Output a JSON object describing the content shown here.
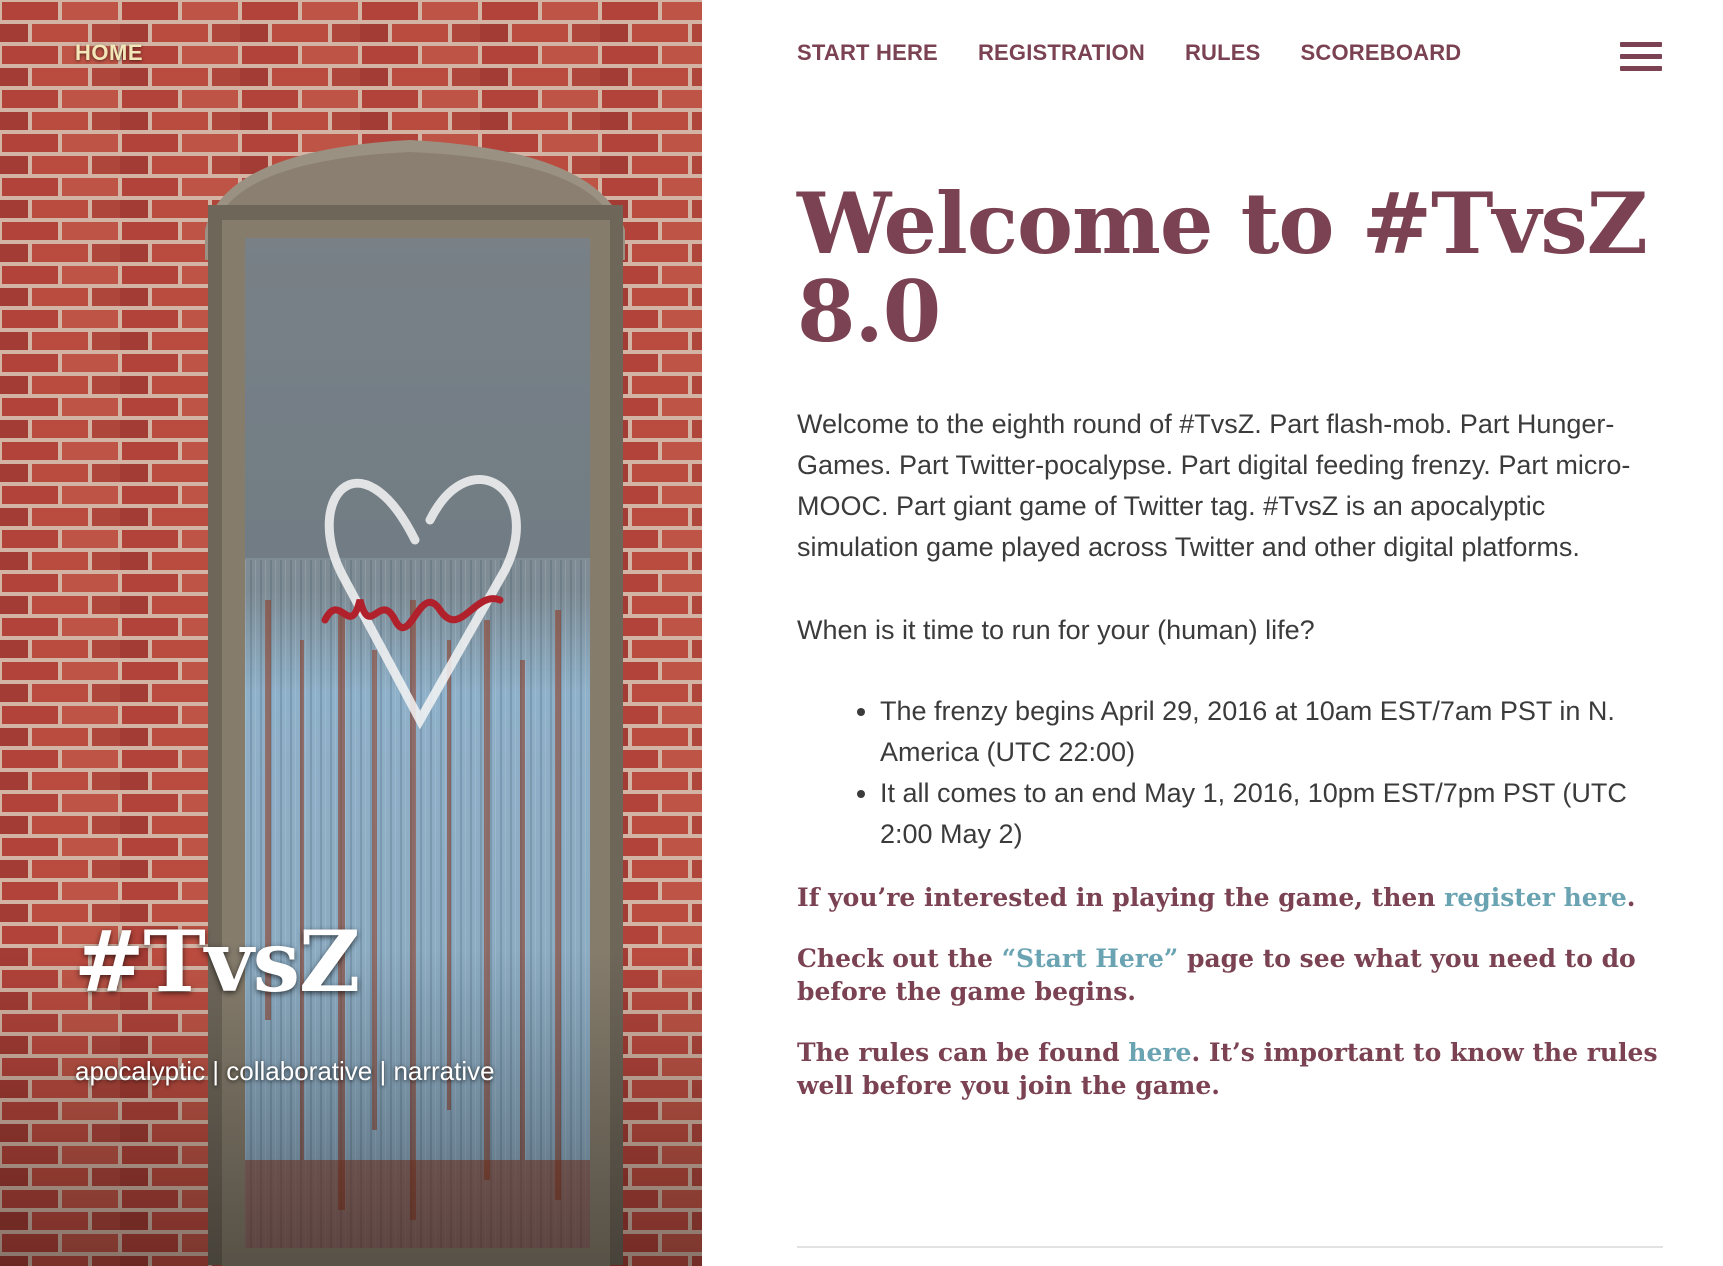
{
  "hero": {
    "home_label": "HOME",
    "site_title": "#TvsZ",
    "tagline": "apocalyptic | collaborative | narrative"
  },
  "nav": {
    "items": [
      {
        "label": "START HERE"
      },
      {
        "label": "REGISTRATION"
      },
      {
        "label": "RULES"
      },
      {
        "label": "SCOREBOARD"
      }
    ]
  },
  "content": {
    "title": "Welcome to #TvsZ 8.0",
    "intro": "Welcome to the eighth round of #TvsZ. Part flash-mob. Part Hunger-Games. Part Twitter-pocalypse. Part digital feeding frenzy. Part micro-MOOC. Part giant game of Twitter tag. #TvsZ is an apocalyptic simulation game played across Twitter and other digital platforms.",
    "question": "When is it time to run for your (human) life?",
    "dates": [
      "The frenzy begins April 29, 2016 at 10am EST/7am PST in N. America (UTC 22:00)",
      "It all comes to an end May 1, 2016, 10pm EST/7pm PST (UTC 2:00 May 2)"
    ],
    "register": {
      "before": "If you’re interested in playing the game, then ",
      "link": "register here",
      "after": "."
    },
    "start": {
      "before": "Check out the ",
      "link": "“Start Here”",
      "after": " page to see what you need to do before the game begins."
    },
    "rules": {
      "before": "The rules can be found ",
      "link": "here",
      "after": ". It’s important to know the rules well before you join the game."
    }
  },
  "colors": {
    "accent": "#7a4252",
    "link": "#6aa3b2",
    "body_text": "#3b3b3b"
  }
}
